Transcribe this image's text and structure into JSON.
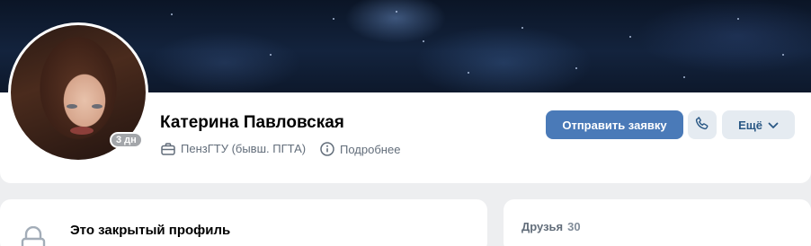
{
  "profile": {
    "name": "Катерина Павловская",
    "online_badge": "3 дн",
    "university": "ПензГТУ (бывш. ПГТА)",
    "details_link": "Подробнее",
    "avatar_icon": "user-photo"
  },
  "actions": {
    "send_request": "Отправить заявку",
    "phone_icon": "phone-icon",
    "more": "Ещё"
  },
  "closed_profile": {
    "title": "Это закрытый профиль",
    "icon": "lock-icon"
  },
  "friends": {
    "label": "Друзья",
    "count": "30"
  },
  "colors": {
    "primary_button": "#4a7ab8",
    "secondary_button": "#e5ebf1",
    "page_background": "#edeef0",
    "link": "#2a5885"
  }
}
